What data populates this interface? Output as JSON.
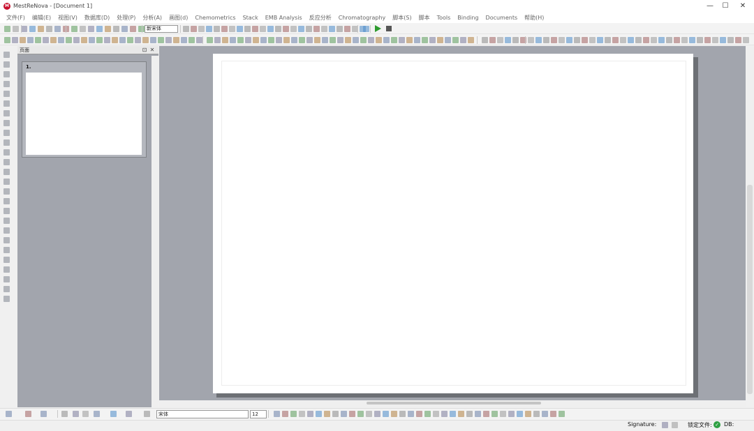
{
  "app": {
    "title": "MestReNova - [Document 1]",
    "logo_text": "M"
  },
  "window_controls": {
    "minimize": "—",
    "maximize": "☐",
    "close": "✕"
  },
  "menu": [
    "文件(F)",
    "编辑(E)",
    "视图(V)",
    "数据库(D)",
    "处理(P)",
    "分析(A)",
    "画图(d)",
    "Chemometrics",
    "Stack",
    "EMB Analysis",
    "反应分析",
    "Chromatography",
    "脚本(S)",
    "脚本",
    "Tools",
    "Binding",
    "Documents",
    "帮助(H)"
  ],
  "toolbar": {
    "font_combo": "新宋体"
  },
  "pages_panel": {
    "title": "页面",
    "pin": "⊡",
    "close": "✕",
    "thumbs": [
      {
        "label": "1."
      }
    ]
  },
  "drawbar": {
    "font_name": "宋体",
    "font_size": "12"
  },
  "status": {
    "signature_label": "Signature:",
    "lock_label": "锁定文件:",
    "db_label": "DB:",
    "ok_icon": "✓"
  },
  "colors": {
    "accent": "#2e9b2e",
    "logo": "#c8102e",
    "workspace": "#a2a5ad"
  }
}
